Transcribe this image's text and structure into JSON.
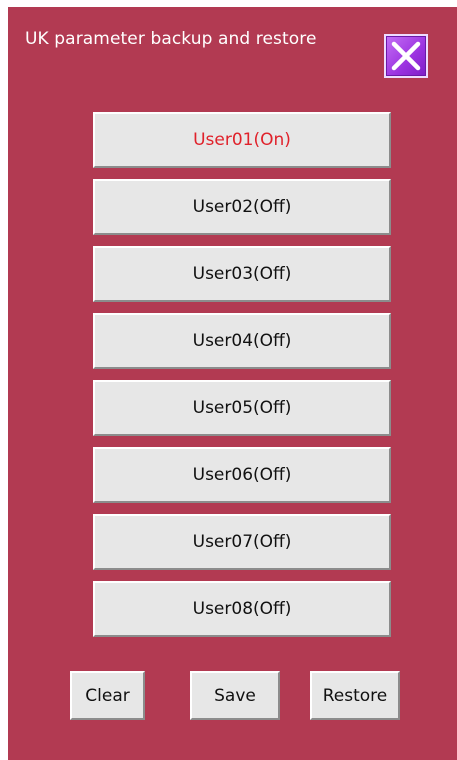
{
  "window": {
    "title": "UK parameter backup and restore",
    "close_icon": "close-x-icon",
    "accent_color": "#b23a52"
  },
  "users": [
    {
      "label": "User01(On)",
      "active": true
    },
    {
      "label": "User02(Off)",
      "active": false
    },
    {
      "label": "User03(Off)",
      "active": false
    },
    {
      "label": "User04(Off)",
      "active": false
    },
    {
      "label": "User05(Off)",
      "active": false
    },
    {
      "label": "User06(Off)",
      "active": false
    },
    {
      "label": "User07(Off)",
      "active": false
    },
    {
      "label": "User08(Off)",
      "active": false
    }
  ],
  "actions": {
    "clear": "Clear",
    "save": "Save",
    "restore": "Restore"
  }
}
